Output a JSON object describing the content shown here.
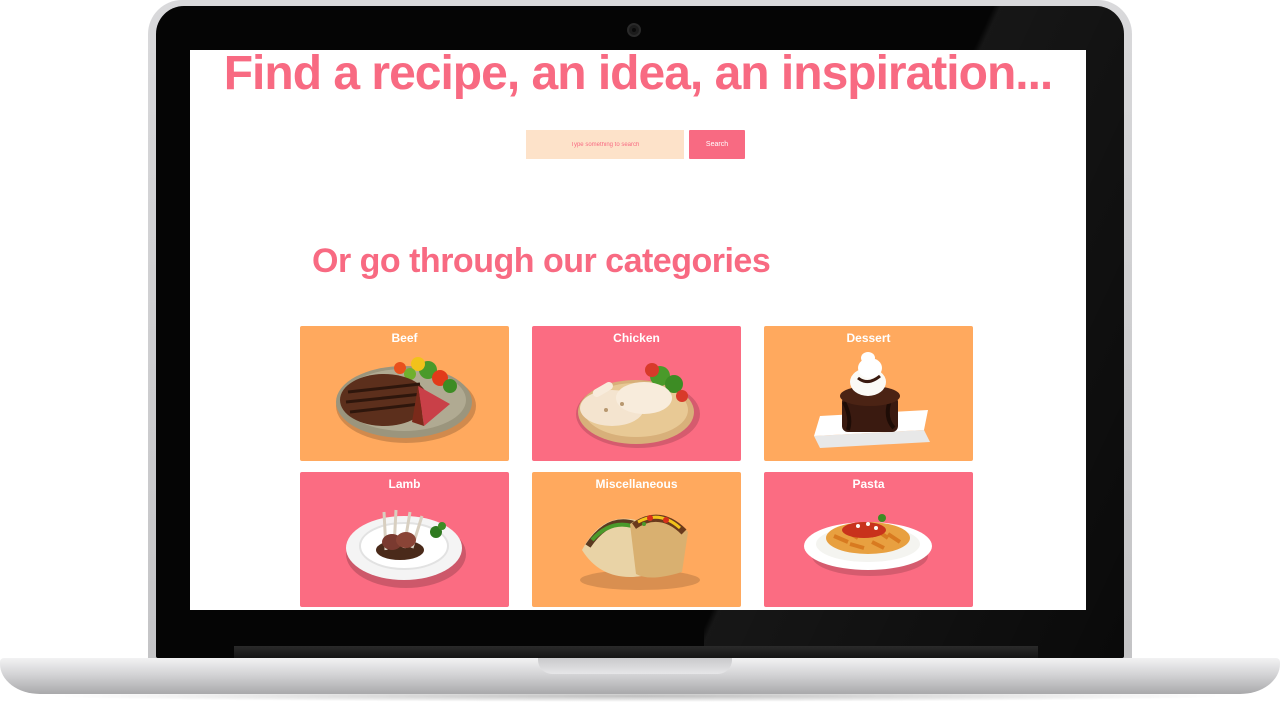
{
  "hero": {
    "title": "Find a recipe, an idea, an inspiration...",
    "search_placeholder": "Type something to search",
    "search_button": "Search"
  },
  "categories_section": {
    "title": "Or go through our categories",
    "items": [
      {
        "label": "Beef",
        "color": "#ffa95e"
      },
      {
        "label": "Chicken",
        "color": "#fb6c82"
      },
      {
        "label": "Dessert",
        "color": "#ffa95e"
      },
      {
        "label": "Lamb",
        "color": "#fb6c82"
      },
      {
        "label": "Miscellaneous",
        "color": "#ffa95e"
      },
      {
        "label": "Pasta",
        "color": "#fb6c82"
      }
    ]
  },
  "colors": {
    "accent": "#f86a82",
    "input_bg": "#fde2c9",
    "card_orange": "#ffa95e",
    "card_pink": "#fb6c82"
  }
}
